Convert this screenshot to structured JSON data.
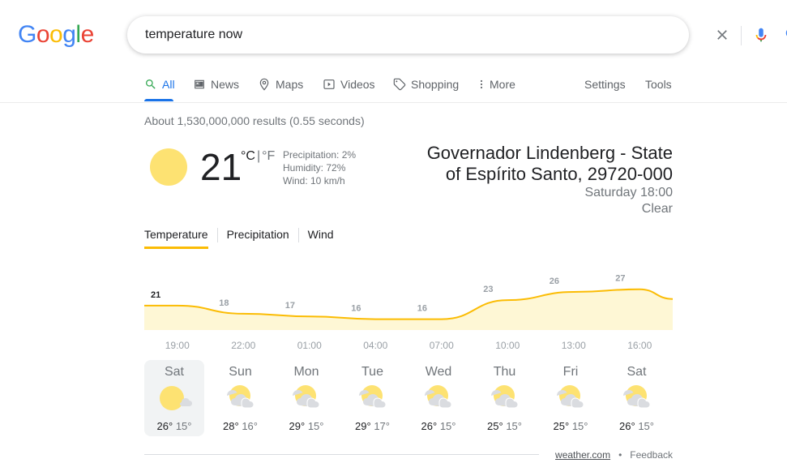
{
  "logo": {
    "letters": [
      "G",
      "o",
      "o",
      "g",
      "l",
      "e"
    ],
    "colors": [
      "#4285f4",
      "#ea4335",
      "#fbbc05",
      "#4285f4",
      "#34a853",
      "#ea4335"
    ]
  },
  "search": {
    "query": "temperature now"
  },
  "tabs": [
    {
      "label": "All",
      "icon": "search-icon",
      "active": true
    },
    {
      "label": "News",
      "icon": "news-icon"
    },
    {
      "label": "Maps",
      "icon": "map-pin-icon"
    },
    {
      "label": "Videos",
      "icon": "play-icon"
    },
    {
      "label": "Shopping",
      "icon": "tag-icon"
    },
    {
      "label": "More",
      "icon": "more-vert-icon"
    }
  ],
  "tools": {
    "settings": "Settings",
    "tools": "Tools"
  },
  "stats": "About 1,530,000,000 results (0.55 seconds)",
  "weather": {
    "temp": "21",
    "unit_c": "°C",
    "unit_sep": "|",
    "unit_f": "°F",
    "precipitation": "Precipitation: 2%",
    "humidity": "Humidity: 72%",
    "wind": "Wind: 10 km/h",
    "location_line1": "Governador Lindenberg - State",
    "location_line2": "of Espírito Santo, 29720-000",
    "day_time": "Saturday 18:00",
    "condition": "Clear",
    "tabs": [
      "Temperature",
      "Precipitation",
      "Wind"
    ]
  },
  "chart_data": {
    "type": "area",
    "x": [
      "19:00",
      "22:00",
      "01:00",
      "04:00",
      "07:00",
      "10:00",
      "13:00",
      "16:00"
    ],
    "values": [
      21,
      18,
      17,
      16,
      16,
      23,
      26,
      27
    ],
    "labels": [
      "21",
      "18",
      "17",
      "16",
      "16",
      "23",
      "26",
      "27"
    ],
    "color": "#fbbc04",
    "fill": "#fef7d5"
  },
  "forecast": [
    {
      "day": "Sat",
      "hi": "26°",
      "lo": "15°",
      "selected": true,
      "icon": "sun-cloud-icon"
    },
    {
      "day": "Sun",
      "hi": "28°",
      "lo": "16°",
      "icon": "partly-cloudy-icon"
    },
    {
      "day": "Mon",
      "hi": "29°",
      "lo": "15°",
      "icon": "partly-cloudy-icon"
    },
    {
      "day": "Tue",
      "hi": "29°",
      "lo": "17°",
      "icon": "partly-cloudy-icon"
    },
    {
      "day": "Wed",
      "hi": "26°",
      "lo": "15°",
      "icon": "partly-cloudy-icon"
    },
    {
      "day": "Thu",
      "hi": "25°",
      "lo": "15°",
      "icon": "partly-cloudy-icon"
    },
    {
      "day": "Fri",
      "hi": "25°",
      "lo": "15°",
      "icon": "partly-cloudy-icon"
    },
    {
      "day": "Sat",
      "hi": "26°",
      "lo": "15°",
      "icon": "partly-cloudy-icon"
    }
  ],
  "footer": {
    "source": "weather.com",
    "dot": "•",
    "feedback": "Feedback"
  }
}
